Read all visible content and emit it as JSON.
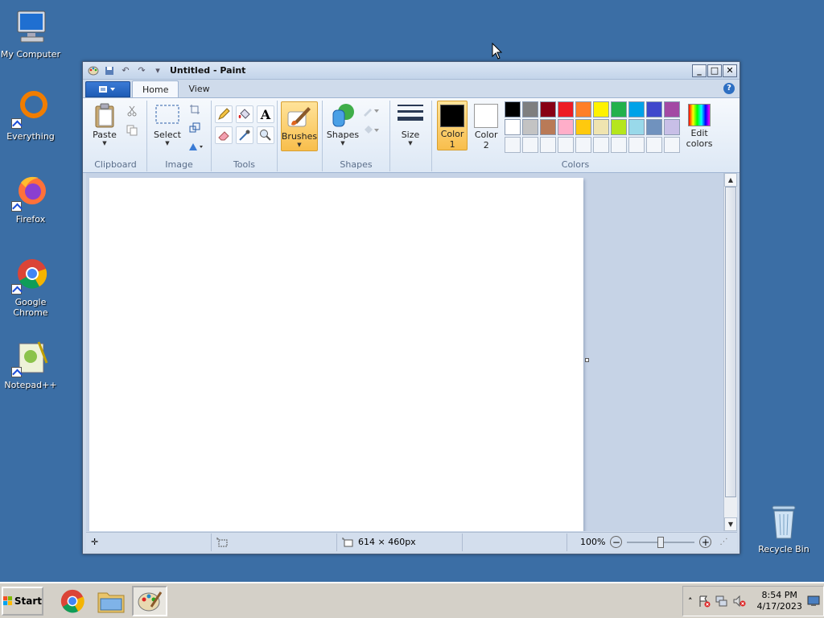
{
  "desktop": {
    "icons": [
      {
        "label": "My Computer"
      },
      {
        "label": "Everything"
      },
      {
        "label": "Firefox"
      },
      {
        "label": "Google Chrome"
      },
      {
        "label": "Notepad++"
      },
      {
        "label": "Recycle Bin"
      }
    ]
  },
  "window": {
    "title": "Untitled - Paint",
    "controls": {
      "minimize": "_",
      "maximize": "□",
      "close": "✕"
    },
    "tabs": [
      {
        "label": "Home",
        "active": true
      },
      {
        "label": "View",
        "active": false
      }
    ],
    "help": "?"
  },
  "ribbon": {
    "clipboard": {
      "group": "Clipboard",
      "paste": "Paste"
    },
    "image": {
      "group": "Image",
      "select": "Select"
    },
    "tools": {
      "group": "Tools",
      "text_glyph": "A"
    },
    "brushes": {
      "label": "Brushes"
    },
    "shapes": {
      "group": "Shapes",
      "label": "Shapes"
    },
    "size": {
      "label": "Size"
    },
    "colors": {
      "group": "Colors",
      "color1_label": "Color",
      "color1_num": "1",
      "color2_label": "Color",
      "color2_num": "2",
      "color1": "#000000",
      "color2": "#ffffff",
      "edit_label1": "Edit",
      "edit_label2": "colors",
      "palette_row1": [
        "#000000",
        "#7f7f7f",
        "#880015",
        "#ed1c24",
        "#ff7f27",
        "#fff200",
        "#22b14c",
        "#00a2e8",
        "#3f48cc",
        "#a349a4"
      ],
      "palette_row2": [
        "#ffffff",
        "#c3c3c3",
        "#b97a57",
        "#ffaec9",
        "#ffc90e",
        "#efe4b0",
        "#b5e61d",
        "#99d9ea",
        "#7092be",
        "#c8bfe7"
      ]
    }
  },
  "statusbar": {
    "canvas_size": "614 × 460px",
    "zoom": "100%",
    "zoom_out": "−",
    "zoom_in": "+"
  },
  "taskbar": {
    "start": "Start",
    "time": "8:54 PM",
    "date": "4/17/2023"
  }
}
